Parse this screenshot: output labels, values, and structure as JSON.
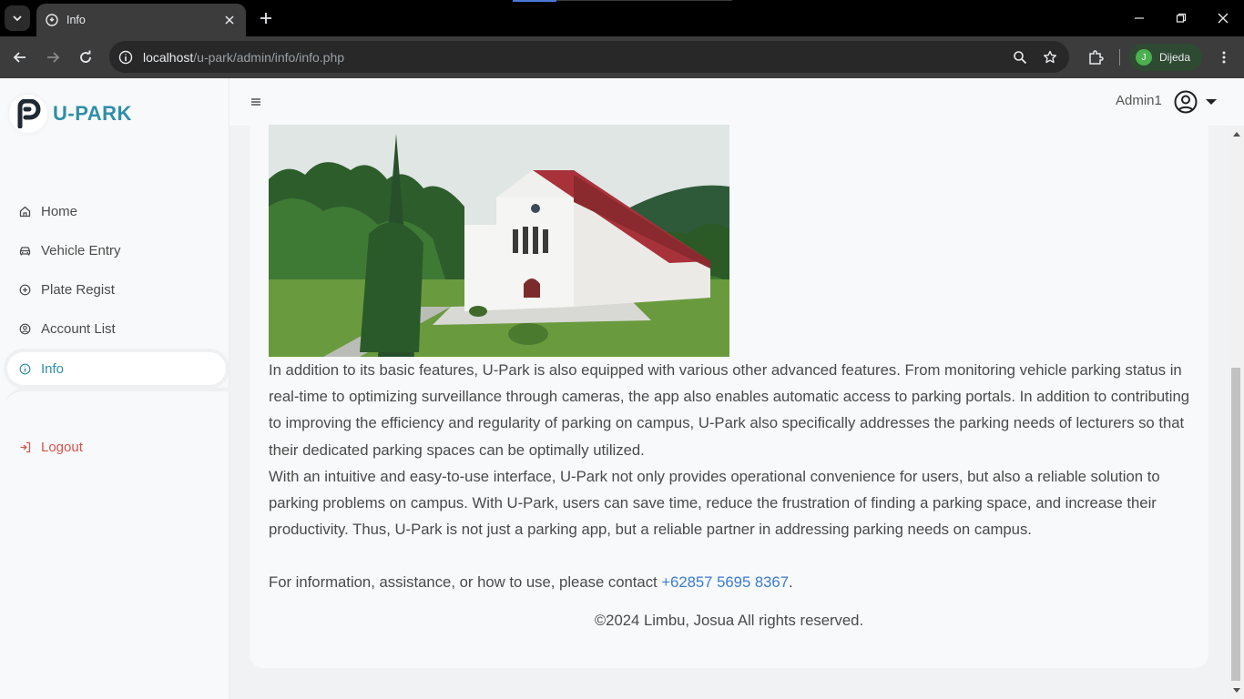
{
  "browser": {
    "tab_title": "Info",
    "url_host": "localhost",
    "url_path": "/u-park/admin/info/info.php",
    "profile_initial": "J",
    "profile_name": "Dijeda"
  },
  "brand": {
    "name": "U-PARK",
    "color": "#2e8fa8"
  },
  "sidebar": {
    "items": [
      {
        "label": "Home",
        "icon": "home-icon"
      },
      {
        "label": "Vehicle Entry",
        "icon": "car-icon"
      },
      {
        "label": "Plate Regist",
        "icon": "plus-circle-icon"
      },
      {
        "label": "Account List",
        "icon": "user-circle-icon"
      },
      {
        "label": "Info",
        "icon": "info-circle-icon",
        "active": true
      }
    ],
    "logout_label": "Logout"
  },
  "topbar": {
    "user_name": "Admin1"
  },
  "content": {
    "paragraph_1": "In addition to its basic features, U-Park is also equipped with various other advanced features. From monitoring vehicle parking status in real-time to optimizing surveillance through cameras, the app also enables automatic access to parking portals. In addition to contributing to improving the efficiency and regularity of parking on campus, U-Park also specifically addresses the parking needs of lecturers so that their dedicated parking spaces can be optimally utilized.",
    "paragraph_2": "With an intuitive and easy-to-use interface, U-Park not only provides operational convenience for users, but also a reliable solution to parking problems on campus. With U-Park, users can save time, reduce the frustration of finding a parking space, and increase their productivity. Thus, U-Park is not just a parking app, but a reliable partner in addressing parking needs on campus.",
    "contact_prefix": "For information, assistance, or how to use, please contact ",
    "contact_phone": "+62857 5695 8367",
    "contact_suffix": ".",
    "copyright": "©2024 Limbu, Josua All rights reserved."
  },
  "colors": {
    "accent": "#2e8fa8",
    "logout": "#d9534f",
    "link": "#3a7bd5"
  }
}
